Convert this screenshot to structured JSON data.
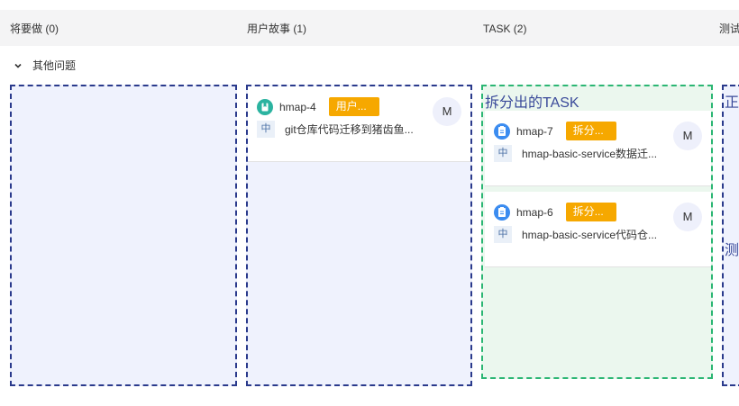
{
  "columns": [
    {
      "title": "将要做 (0)"
    },
    {
      "title": "用户故事 (1)"
    },
    {
      "title": "TASK (2)"
    },
    {
      "title": "测试"
    }
  ],
  "swimlane": {
    "label": "其他问题"
  },
  "story_card": {
    "key": "hmap-4",
    "tag": "用户...",
    "priority": "中",
    "summary": "git仓库代码迁移到猪齿鱼...",
    "assignee": "M"
  },
  "task_group": {
    "title": "拆分出的TASK",
    "cards": [
      {
        "key": "hmap-7",
        "tag": "拆分...",
        "priority": "中",
        "summary": "hmap-basic-service数据迁...",
        "assignee": "M"
      },
      {
        "key": "hmap-6",
        "tag": "拆分...",
        "priority": "中",
        "summary": "hmap-basic-service代码仓...",
        "assignee": "M"
      }
    ]
  },
  "right_partial": {
    "label_top": "正",
    "label_mid": "测"
  },
  "colors": {
    "story_icon": "#2bb3a0",
    "task_icon": "#3b8cf0",
    "tag": "#f6a800",
    "drop_blue": "#2a3a8c",
    "drop_green": "#2bb673"
  }
}
